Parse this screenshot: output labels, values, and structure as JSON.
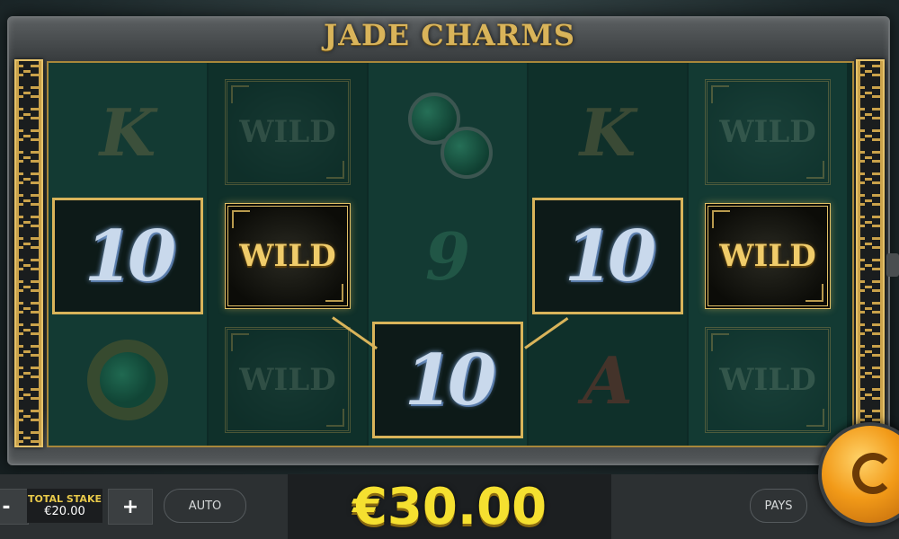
{
  "title": "JADE CHARMS",
  "reels": {
    "symbols": {
      "wild": "WILD",
      "ten": "10",
      "k": "K",
      "a": "A",
      "nine": "9"
    }
  },
  "bottom_bar": {
    "minus_label": "-",
    "plus_label": "+",
    "total_stake_label": "TOTAL STAKE",
    "total_stake_value": "€20.00",
    "auto_label": "AUTO",
    "win_amount": "€30.00",
    "pays_label": "PAYS"
  },
  "icons": {
    "spin": "spin-icon"
  },
  "colors": {
    "gold": "#d9b45a",
    "win_yellow": "#f5e030",
    "reel_green": "#133a33",
    "spin_orange": "#f29a18"
  }
}
